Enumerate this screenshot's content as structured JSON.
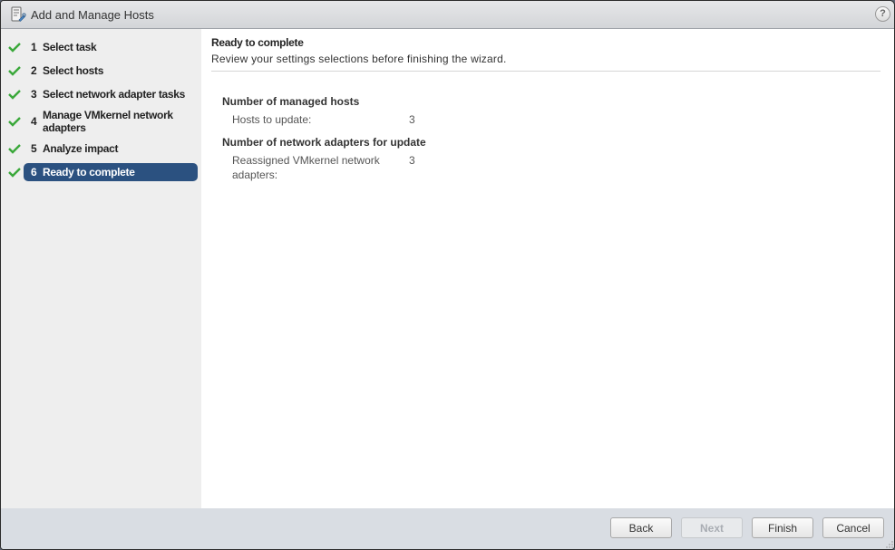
{
  "window": {
    "title": "Add and Manage Hosts",
    "title_icon": "host-wizard-icon",
    "help_label": "?"
  },
  "sidebar": {
    "steps": [
      {
        "number": "1",
        "label": "Select task",
        "completed": true,
        "active": false
      },
      {
        "number": "2",
        "label": "Select hosts",
        "completed": true,
        "active": false
      },
      {
        "number": "3",
        "label": "Select network adapter tasks",
        "completed": true,
        "active": false
      },
      {
        "number": "4",
        "label": "Manage VMkernel network adapters",
        "completed": true,
        "active": false
      },
      {
        "number": "5",
        "label": "Analyze impact",
        "completed": true,
        "active": false
      },
      {
        "number": "6",
        "label": "Ready to complete",
        "completed": true,
        "active": true
      }
    ]
  },
  "content": {
    "title": "Ready to complete",
    "subtitle": "Review your settings selections before finishing the wizard.",
    "sections": [
      {
        "title": "Number of managed hosts",
        "rows": [
          {
            "label": "Hosts to update:",
            "value": "3"
          }
        ]
      },
      {
        "title": "Number of network adapters for update",
        "rows": [
          {
            "label": "Reassigned VMkernel network adapters:",
            "value": "3"
          }
        ]
      }
    ]
  },
  "footer": {
    "back_label": "Back",
    "next_label": "Next",
    "finish_label": "Finish",
    "cancel_label": "Cancel"
  },
  "colors": {
    "active_step": "#2b5180",
    "check": "#3aa83a",
    "footer_bg": "#d9dde3",
    "sidebar_bg": "#eeeeee"
  }
}
